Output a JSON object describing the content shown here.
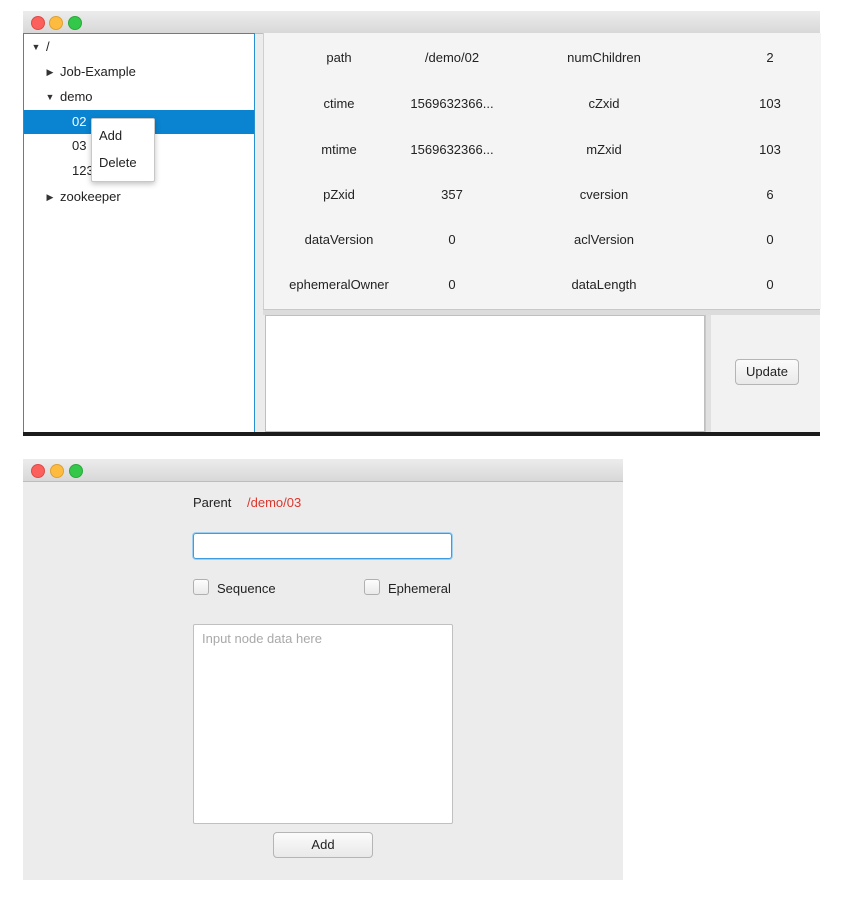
{
  "tree": {
    "items": [
      {
        "label": "/",
        "expanded": true
      },
      {
        "label": "Job-Example",
        "expanded": false
      },
      {
        "label": "demo",
        "expanded": true
      },
      {
        "label": "02",
        "selected": true
      },
      {
        "label": "03"
      },
      {
        "label": "123"
      },
      {
        "label": "zookeeper",
        "expanded": false
      }
    ]
  },
  "context_menu": {
    "items": [
      "Add",
      "Delete"
    ]
  },
  "properties": [
    {
      "name": "path",
      "value": "/demo/02",
      "name2": "numChildren",
      "value2": "2"
    },
    {
      "name": "ctime",
      "value": "1569632366...",
      "name2": "cZxid",
      "value2": "103"
    },
    {
      "name": "mtime",
      "value": "1569632366...",
      "name2": "mZxid",
      "value2": "103"
    },
    {
      "name": "pZxid",
      "value": "357",
      "name2": "cversion",
      "value2": "6"
    },
    {
      "name": "dataVersion",
      "value": "0",
      "name2": "aclVersion",
      "value2": "0"
    },
    {
      "name": "ephemeralOwner",
      "value": "0",
      "name2": "dataLength",
      "value2": "0"
    }
  ],
  "update_button": "Update",
  "add_dialog": {
    "parent_label": "Parent",
    "parent_value": "/demo/03",
    "sequence_label": "Sequence",
    "ephemeral_label": "Ephemeral",
    "data_placeholder": "Input node data here",
    "add_button": "Add"
  },
  "colors": {
    "selection": "#0a84d0",
    "parent_value": "#d9382e",
    "focus": "#3d9de0"
  }
}
